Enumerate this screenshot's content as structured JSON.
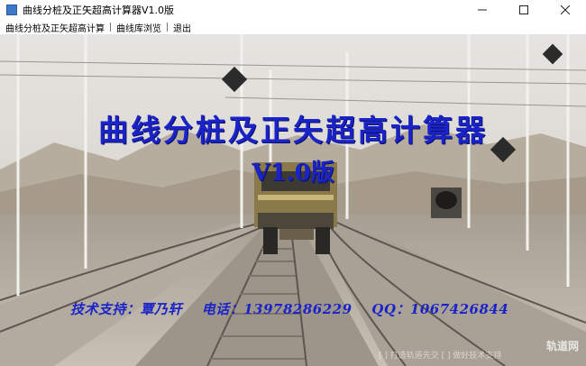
{
  "window": {
    "title": "曲线分桩及正矢超高计算器V1.0版",
    "controls": {
      "minimize": "minimize-icon",
      "maximize": "maximize-icon",
      "close": "close-icon"
    }
  },
  "menu": {
    "items": [
      {
        "label": "曲线分桩及正矢超高计算"
      },
      {
        "label": "曲线库浏览"
      },
      {
        "label": "退出"
      }
    ]
  },
  "splash": {
    "title": "曲线分桩及正矢超高计算器",
    "version": "V1.0版",
    "support_label": "技术支持：覃乃轩",
    "phone_label": "电话：13978286229",
    "qq_label": "QQ：1067426844"
  },
  "watermark": {
    "logo": "轨道网",
    "slogan": "[  ]  打造轨道先交 [  ] 做好技术支持"
  },
  "colors": {
    "title_text": "#1a23c8",
    "sky": "#dcdad6",
    "ground": "#b9b1a6"
  }
}
